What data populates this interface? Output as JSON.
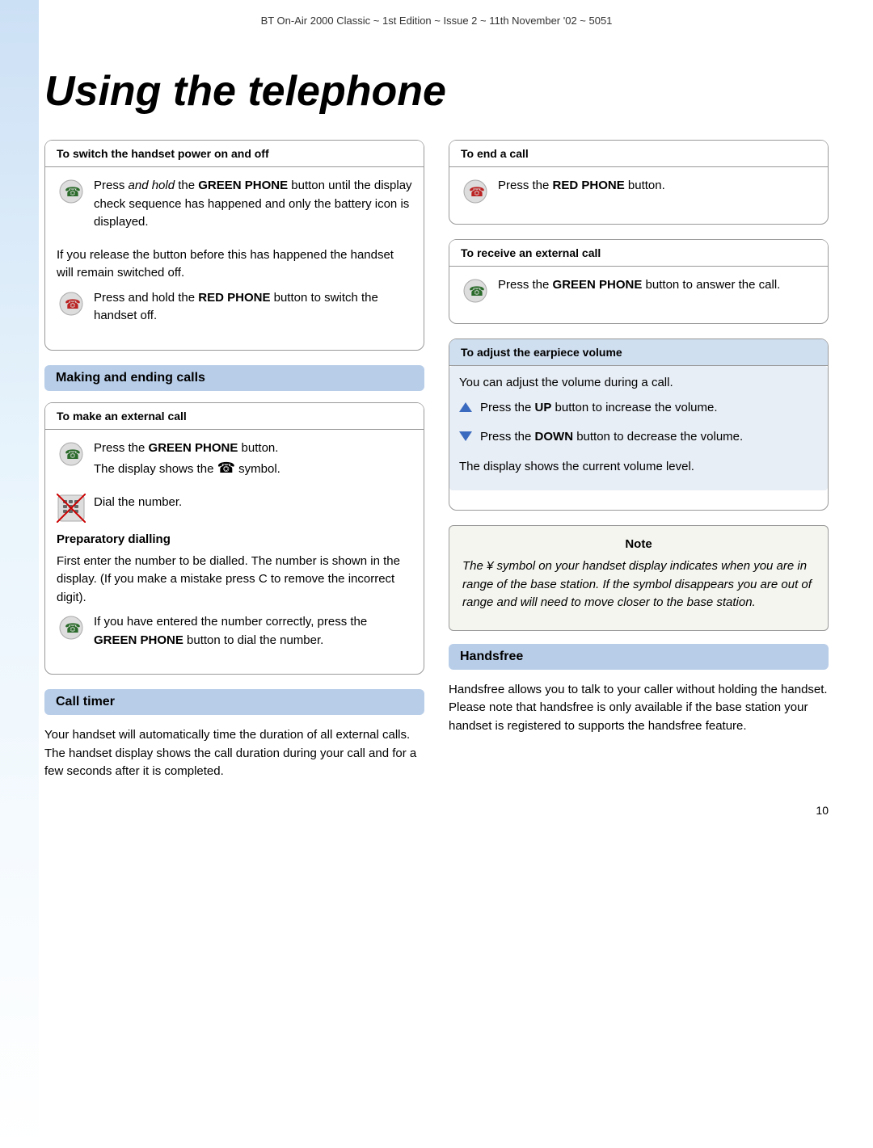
{
  "header": {
    "text": "BT On-Air 2000 Classic ~ 1st Edition ~ Issue 2 ~ 11th November '02 ~ 5051"
  },
  "page_title": "Using the telephone",
  "left_column": {
    "box1": {
      "header": "To switch the handset power on and off",
      "para1_prefix": "Press ",
      "para1_italic": "and hold",
      "para1_bold": "GREEN PHONE",
      "para1_suffix": " button until the display check sequence has happened and only the battery icon is displayed.",
      "para2": "If you release the button before this has happened the handset will remain switched off.",
      "para3_prefix": "Press and hold the ",
      "para3_bold": "RED PHONE",
      "para3_suffix": " button to switch the handset off."
    },
    "section1": {
      "band_label": "Making and ending calls",
      "box2": {
        "header": "To make an external call",
        "para1_prefix": "Press the ",
        "para1_bold": "GREEN PHONE",
        "para1_suffix": " button.",
        "para1b_prefix": "The display shows the ",
        "para1b_suffix": " symbol.",
        "para2": "Dial the number.",
        "subheading": "Preparatory dialling",
        "para3": "First enter the number to be dialled. The number is shown in the display. (If you make a mistake press C to remove the incorrect digit).",
        "para4_prefix": "If you have entered the number correctly, press the ",
        "para4_bold": "GREEN PHONE",
        "para4_suffix": " button to dial the number."
      }
    },
    "call_timer": {
      "band_label": "Call timer",
      "text": "Your handset will automatically time the duration of all external calls. The handset display shows the call duration during your call and for a few seconds after it is completed."
    }
  },
  "right_column": {
    "box_end_call": {
      "header": "To end a call",
      "para_prefix": "Press the ",
      "para_bold": "RED PHONE",
      "para_suffix": " button."
    },
    "box_receive": {
      "header": "To receive an external call",
      "para_prefix": "Press the ",
      "para_bold": "GREEN PHONE",
      "para_suffix": " button to answer the call."
    },
    "box_volume": {
      "header": "To adjust the earpiece volume",
      "para1": "You can adjust the volume during a call.",
      "para2_prefix": "Press the ",
      "para2_bold": "UP",
      "para2_suffix": " button to increase the volume.",
      "para3_prefix": "Press the ",
      "para3_bold": "DOWN",
      "para3_suffix": " button to decrease the volume.",
      "para4": "The display shows the current volume level."
    },
    "note": {
      "title": "Note",
      "text": "The ¥ symbol on your handset display indicates when you are in range of the base station. If the symbol disappears you are out of range and will need to move closer to the base station."
    },
    "handsfree": {
      "band_label": "Handsfree",
      "text": "Handsfree allows you to talk to your caller without holding the handset. Please note that handsfree is only available if the base station your handset is registered to supports the handsfree feature."
    }
  },
  "page_number": "10",
  "icons": {
    "green_phone": "📞",
    "red_phone": "📵",
    "keypad": "⌨"
  }
}
